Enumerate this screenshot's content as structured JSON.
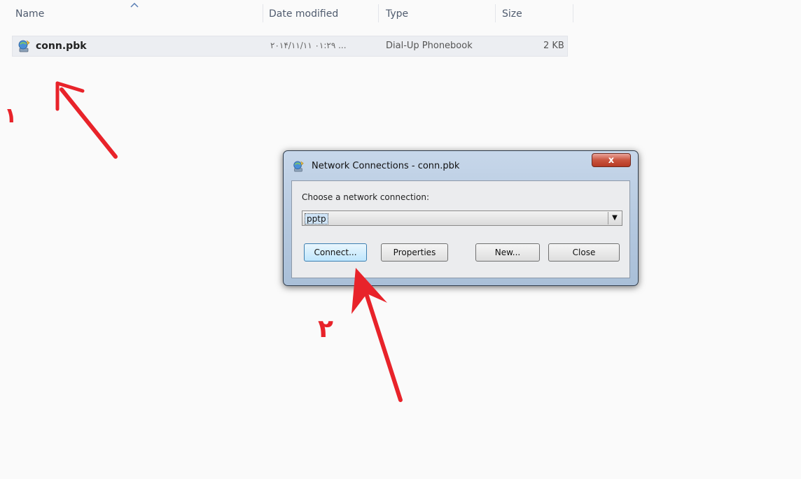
{
  "explorer": {
    "columns": {
      "name": "Name",
      "date_modified": "Date modified",
      "type": "Type",
      "size": "Size"
    },
    "file": {
      "name": "conn.pbk",
      "date_modified": "۲۰۱۴/۱۱/۱۱ ۰۱:۲۹ ...",
      "type": "Dial-Up Phonebook",
      "size": "2 KB"
    }
  },
  "dialog": {
    "title": "Network Connections - conn.pbk",
    "close_label": "x",
    "choose_label": "Choose a network connection:",
    "selected_connection": "pptp",
    "buttons": {
      "connect": "Connect...",
      "properties": "Properties",
      "new": "New...",
      "close": "Close"
    }
  },
  "annotations": {
    "step1": "۱",
    "step2": "۲",
    "arrow_color": "#e8232a"
  }
}
